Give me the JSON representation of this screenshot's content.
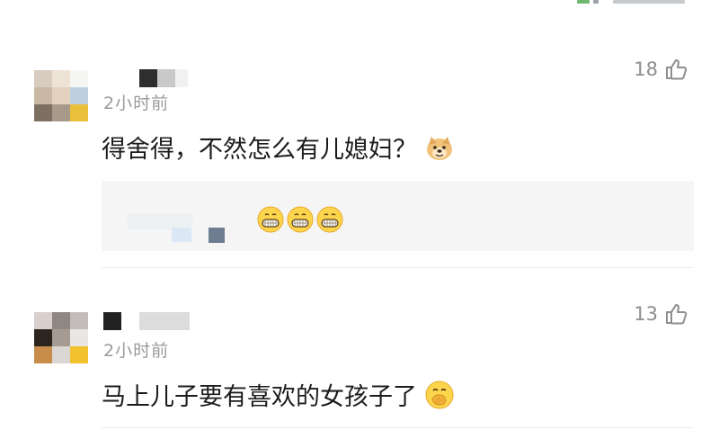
{
  "comments": [
    {
      "time": "2小时前",
      "likes": "18",
      "text": "得舍得，不然怎么有儿媳妇？",
      "emoji": "doge-emoji",
      "reply": {
        "emojis": [
          "grin-emoji",
          "grin-emoji",
          "grin-emoji"
        ]
      }
    },
    {
      "time": "2小时前",
      "likes": "13",
      "text": "马上儿子要有喜欢的女孩子了",
      "emoji": "hand-over-mouth-emoji"
    }
  ],
  "icons": {
    "like": "thumbs-up-outline-icon"
  },
  "colors": {
    "time": "#9a9a9a",
    "likes": "#8e8e8e",
    "text": "#1c1c1c",
    "reply_bg": "#f5f5f5"
  }
}
